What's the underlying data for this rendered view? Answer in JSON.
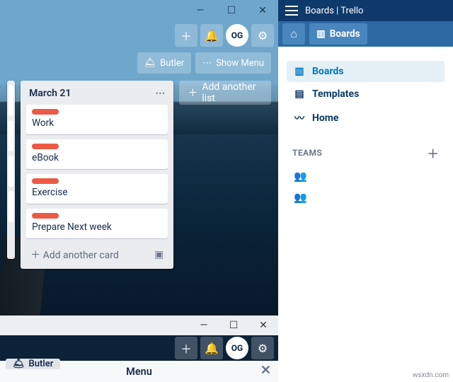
{
  "leftWindow": {
    "toolbar": {
      "avatar_initials": "OG"
    },
    "buttons": {
      "butler": "Butler",
      "showMenu": "Show Menu",
      "addList": "Add another list"
    },
    "list": {
      "title": "March 21",
      "cards": [
        {
          "title": "Work"
        },
        {
          "title": "eBook"
        },
        {
          "title": "Exercise"
        },
        {
          "title": "Prepare Next week"
        }
      ],
      "addCard": "Add another card"
    }
  },
  "bottomWindow": {
    "toolbar": {
      "avatar_initials": "OG"
    },
    "butler": "Butler",
    "menuTitle": "Menu"
  },
  "rightWindow": {
    "title": "Boards | Trello",
    "nav": {
      "boards": "Boards"
    },
    "sidebar": {
      "items": [
        {
          "label": "Boards"
        },
        {
          "label": "Templates"
        },
        {
          "label": "Home"
        }
      ],
      "teamsHeader": "TEAMS"
    }
  },
  "watermark": "wsxdn.com"
}
